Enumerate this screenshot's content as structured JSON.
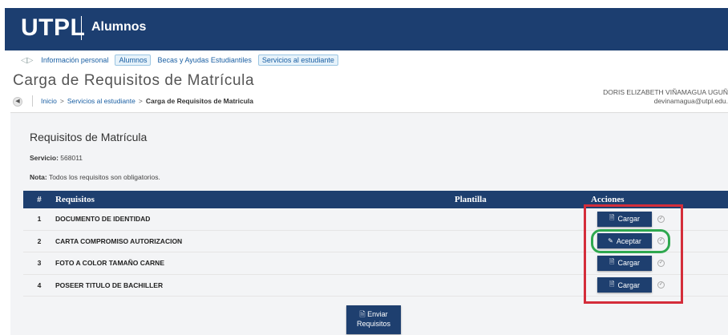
{
  "header": {
    "brand": "UTPL",
    "subtitle": "Alumnos"
  },
  "nav": {
    "items": [
      {
        "label": "Información personal",
        "selected": false
      },
      {
        "label": "Alumnos",
        "selected": true
      },
      {
        "label": "Becas y Ayudas Estudiantiles",
        "selected": false
      },
      {
        "label": "Servicios al estudiante",
        "selected": true
      }
    ]
  },
  "page": {
    "title": "Carga de Requisitos de Matrícula",
    "breadcrumb": {
      "inicio": "Inicio",
      "sep1": ">",
      "servicios": "Servicios al estudiante",
      "sep2": ">",
      "current": "Carga de Requisitos de Matricula"
    }
  },
  "user": {
    "name": "DORIS ELIZABETH VIÑAMAGUA UGUÑ",
    "email": "devinamagua@utpl.edu."
  },
  "panel": {
    "title": "Requisitos de Matrícula",
    "servicio_label": "Servicio:",
    "servicio_value": "568011",
    "nota_label": "Nota:",
    "nota_text": "Todos los requisitos son obligatorios."
  },
  "table": {
    "headers": {
      "num": "#",
      "requisitos": "Requisitos",
      "plantilla": "Plantilla",
      "acciones": "Acciones"
    },
    "rows": [
      {
        "num": "1",
        "name": "DOCUMENTO DE IDENTIDAD",
        "action": "Cargar"
      },
      {
        "num": "2",
        "name": "CARTA COMPROMISO AUTORIZACION",
        "action": "Aceptar"
      },
      {
        "num": "3",
        "name": "FOTO A COLOR TAMAÑO CARNE",
        "action": "Cargar"
      },
      {
        "num": "4",
        "name": "POSEER TITULO DE BACHILLER",
        "action": "Cargar"
      }
    ]
  },
  "send_button": {
    "line1": "Enviar",
    "line2": "Requisitos"
  },
  "colors": {
    "primary": "#1e3f6f",
    "highlight_red": "#d42d3a",
    "highlight_green": "#2fa84f"
  }
}
